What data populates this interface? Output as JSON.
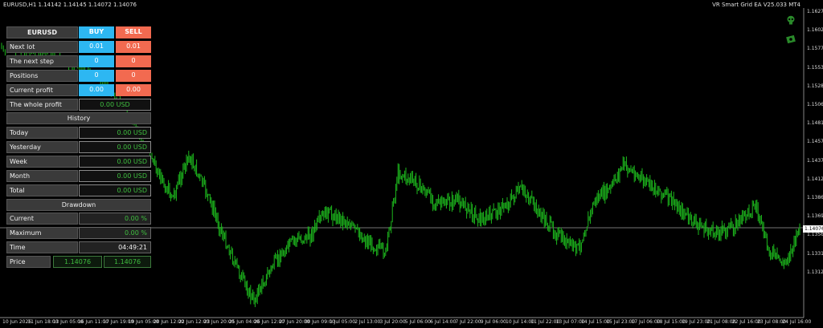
{
  "header": {
    "symbol_line": "EURUSD,H1  1.14142 1.14145 1.14072 1.14076",
    "ea_name": "VR Smart Grid EA V25.033 MT4"
  },
  "icons": [
    "skull-icon",
    "money-icon"
  ],
  "colors": {
    "background": "#000000",
    "candle": "#1db81d",
    "buy": "#2db7f2",
    "sell": "#f26a50",
    "value_text": "#3fbf3f"
  },
  "current_price": "1.14076",
  "y_axis": [
    "1.16270",
    "1.16025",
    "1.15775",
    "1.15530",
    "1.15280",
    "1.15060",
    "1.14810",
    "1.14570",
    "1.14375",
    "1.14120",
    "1.13860",
    "1.13690",
    "1.13560",
    "1.13310",
    "1.13120"
  ],
  "x_axis": [
    "10 Jun 2026",
    "11 Jun 18:00",
    "13 Jun 05:00",
    "16 Jun 11:00",
    "17 Jun 19:00",
    "19 Jun 05:00",
    "20 Jun 12:00",
    "22 Jun 12:00",
    "23 Jun 20:00",
    "25 Jun 04:00",
    "26 Jun 12:00",
    "27 Jun 20:00",
    "30 Jun 09:00",
    "1 Jul 05:00",
    "2 Jul 13:00",
    "3 Jul 20:00",
    "5 Jul 06:00",
    "6 Jul 14:00",
    "7 Jul 22:00",
    "9 Jul 06:00",
    "10 Jul 14:00",
    "11 Jul 22:00",
    "13 Jul 07:00",
    "14 Jul 15:00",
    "15 Jul 23:00",
    "17 Jul 06:00",
    "18 Jul 15:00",
    "19 Jul 23:00",
    "21 Jul 08:00",
    "22 Jul 16:00",
    "23 Jul 08:00",
    "24 Jul 16:00"
  ],
  "panel": {
    "symbol": "EURUSD",
    "buy_header": "BUY",
    "sell_header": "SELL",
    "rows": [
      {
        "label": "Next lot",
        "buy": "0.01",
        "sell": "0.01"
      },
      {
        "label": "The next step",
        "buy": "0",
        "sell": "0"
      },
      {
        "label": "Positions",
        "buy": "0",
        "sell": "0"
      },
      {
        "label": "Current profit",
        "buy": "0.00",
        "sell": "0.00"
      }
    ],
    "whole_profit_label": "The whole profit",
    "whole_profit_value": "0.00 USD",
    "history_title": "History",
    "history": [
      {
        "label": "Today",
        "value": "0.00 USD"
      },
      {
        "label": "Yesterday",
        "value": "0.00 USD"
      },
      {
        "label": "Week",
        "value": "0.00 USD"
      },
      {
        "label": "Month",
        "value": "0.00 USD"
      },
      {
        "label": "Total",
        "value": "0.00 USD"
      }
    ],
    "drawdown_title": "Drawdown",
    "drawdown": [
      {
        "label": "Current",
        "value": "0.00 %"
      },
      {
        "label": "Maximum",
        "value": "0.00 %"
      }
    ],
    "time_label": "Time",
    "time_value": "04:49:21",
    "price_label": "Price",
    "price_bid": "1.14076",
    "price_ask": "1.14076"
  }
}
